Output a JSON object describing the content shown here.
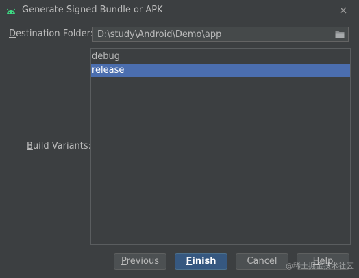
{
  "window": {
    "title": "Generate Signed Bundle or APK"
  },
  "destination": {
    "label_mnemonic": "D",
    "label_rest": "estination Folder:",
    "path": "D:\\study\\Android\\Demo\\app"
  },
  "variants": {
    "label_mnemonic": "B",
    "label_rest": "uild Variants:",
    "items": [
      "debug",
      "release"
    ],
    "selected": "release"
  },
  "buttons": {
    "previous_mnemonic": "P",
    "previous_rest": "revious",
    "finish_mnemonic": "F",
    "finish_rest": "inish",
    "cancel": "Cancel",
    "help_mnemonic": "H",
    "help_rest": "elp"
  },
  "watermark": "@稀土掘金技术社区",
  "colors": {
    "background": "#3c3f41",
    "selection": "#4b6eaf",
    "primary_button": "#365880",
    "android_green": "#3ddc84"
  },
  "icons": {
    "title_icon": "android-icon",
    "close": "close-icon",
    "browse": "folder-icon"
  }
}
